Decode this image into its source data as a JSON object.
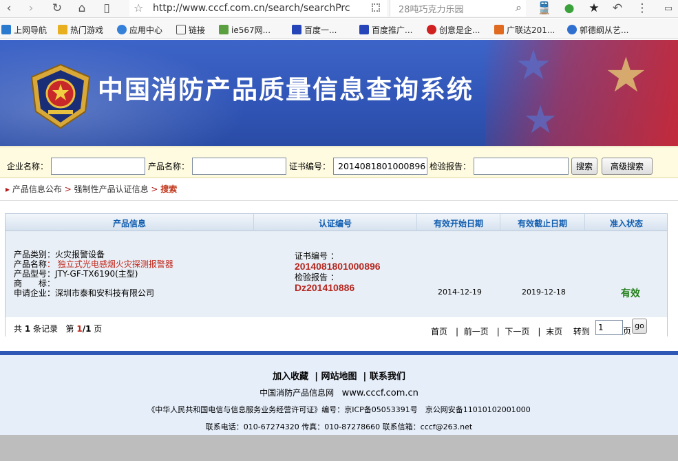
{
  "browser": {
    "url": "http://www.cccf.com.cn/search/searchPrc",
    "search_text": "28吨巧克力乐园",
    "bookmarks": [
      "上网导航",
      "热门游戏",
      "应用中心",
      "链接",
      "ie567网...",
      "百度一...",
      "百度推广...",
      "创意是企...",
      "广联达201...",
      "郭德纲从艺..."
    ]
  },
  "banner": {
    "title": "中国消防产品质量信息查询系统"
  },
  "search": {
    "company_label": "企业名称：",
    "company_value": "",
    "product_label": "产品名称：",
    "product_value": "",
    "cert_label": "证书编号：",
    "cert_value": "2014081801000896",
    "report_label": "检验报告：",
    "report_value": "",
    "search_btn": "搜索",
    "advanced_btn": "高级搜索"
  },
  "breadcrumb": {
    "item1": "产品信息公布",
    "item2": "强制性产品认证信息",
    "item3": "搜索"
  },
  "table": {
    "headers": [
      "产品信息",
      "认证编号",
      "有效开始日期",
      "有效截止日期",
      "准入状态"
    ],
    "row": {
      "category_label": "产品类别",
      "category_value": "：火灾报警设备",
      "name_label": "产品名称",
      "name_value": "： 独立式光电感烟火灾探测报警器",
      "model_label": "产品型号",
      "model_value": "：JTY-GF-TX6190(主型)",
      "brand_label": "商　　标",
      "brand_value": "：",
      "applicant_label": "申请企业",
      "applicant_value": "：深圳市泰和安科技有限公司",
      "cert_no_label": "证书编号 ：",
      "cert_no": "2014081801000896",
      "report_label": "检验报告 ：",
      "report_no": "Dz201410886",
      "start_date": "2014-12-19",
      "end_date": "2019-12-18",
      "status": "有效"
    },
    "footer": {
      "total_prefix": "共",
      "total": "1",
      "total_suffix": "条记录",
      "page_prefix": "第",
      "page_current": "1",
      "page_sep": "/",
      "page_total": "1",
      "page_suffix": "页",
      "first": "首页",
      "prev": "前一页",
      "next": "下一页",
      "last": "末页",
      "goto_label": "转到",
      "goto_value": "1",
      "goto_unit": "页",
      "go_btn": "go"
    }
  },
  "footer": {
    "link1": "加入收藏",
    "link2": "网站地图",
    "link3": "联系我们",
    "site_name": "中国消防产品信息网",
    "site_url": "www.cccf.com.cn",
    "license": "《中华人民共和国电信与信息服务业务经营许可证》编号：京ICP备05053391号　京公网安备11010102001000",
    "contact": "联系电话：010-67274320 传真：010-87278660 联系信箱：cccf@263.net"
  }
}
